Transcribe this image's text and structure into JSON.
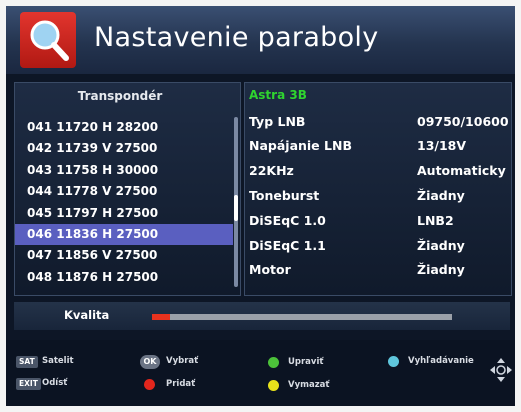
{
  "header": {
    "title": "Nastavenie paraboly",
    "icon": "search-icon"
  },
  "transponder_list": {
    "header": "Transpondér",
    "items": [
      {
        "label": "041 11720 H 28200",
        "selected": false
      },
      {
        "label": "042 11739 V 27500",
        "selected": false
      },
      {
        "label": "043 11758 H 30000",
        "selected": false
      },
      {
        "label": "044 11778 V 27500",
        "selected": false
      },
      {
        "label": "045 11797 H 27500",
        "selected": false
      },
      {
        "label": "046 11836 H 27500",
        "selected": true
      },
      {
        "label": "047 11856 V 27500",
        "selected": false
      },
      {
        "label": "048 11876 H 27500",
        "selected": false
      }
    ]
  },
  "details": {
    "satellite": "Astra 3B",
    "rows": [
      {
        "label": "Typ LNB",
        "value": "09750/10600"
      },
      {
        "label": "Napájanie LNB",
        "value": "13/18V"
      },
      {
        "label": "22KHz",
        "value": "Automaticky"
      },
      {
        "label": "Toneburst",
        "value": "Žiadny"
      },
      {
        "label": "DiSEqC 1.0",
        "value": "LNB2"
      },
      {
        "label": "DiSEqC 1.1",
        "value": "Žiadny"
      },
      {
        "label": "Motor",
        "value": "Žiadny"
      }
    ]
  },
  "quality": {
    "label": "Kvalita",
    "level": 0.06
  },
  "legend": {
    "sat_key": "SAT",
    "sat_label": "Satelit",
    "exit_key": "EXIT",
    "exit_label": "Odísť",
    "ok_key": "OK",
    "ok_label": "Vybrať",
    "red_label": "Pridať",
    "green_label": "Upraviť",
    "yellow_label": "Vymazať",
    "blue_label": "Vyhľadávanie"
  },
  "colors": {
    "selected_row": "#5a5fc0",
    "satellite_name": "#2fd42f",
    "quality_fill": "#e8321e",
    "red_key": "#e3261d",
    "green_key": "#4cc23a",
    "yellow_key": "#e8e21b",
    "blue_key": "#5fc6dc"
  }
}
